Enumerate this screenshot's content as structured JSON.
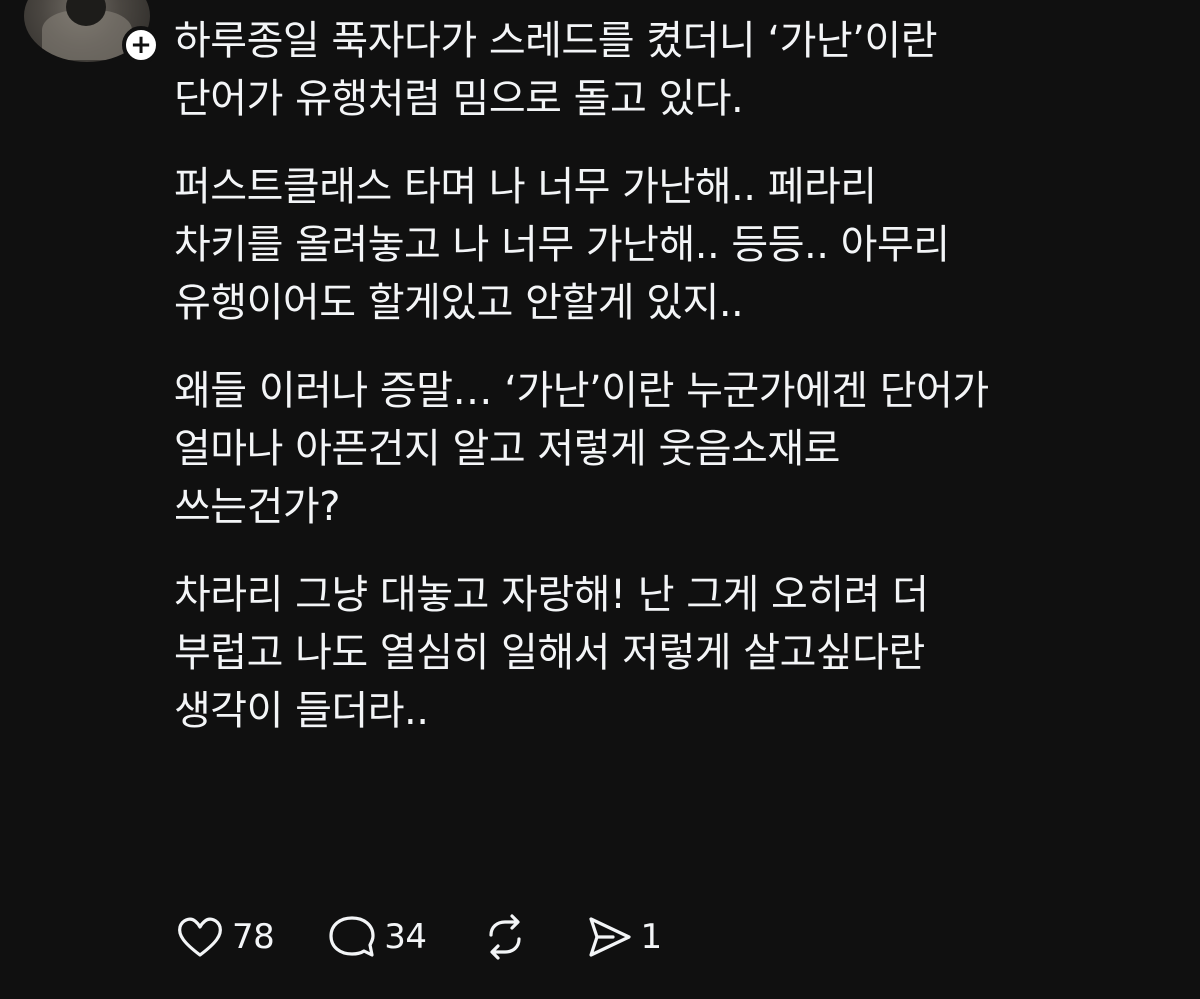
{
  "post": {
    "paragraphs": [
      "하루종일 푹자다가 스레드를 켰더니 ‘가난’이란\n단어가 유행처럼 밈으로 돌고 있다.",
      "퍼스트클래스 타며 나 너무 가난해.. 페라리\n차키를 올려놓고 나 너무 가난해.. 등등.. 아무리\n유행이어도 할게있고 안할게 있지..",
      "왜들 이러나 증말… ‘가난’이란 누군가에겐 단어가\n얼마나 아픈건지 알고 저렇게 웃음소재로\n쓰는건가?",
      "차라리 그냥 대놓고 자랑해! 난 그게 오히려 더\n부럽고 나도 열심히 일해서 저렇게 살고싶다란\n생각이 들더라.."
    ]
  },
  "author": {
    "follow_badge": "+"
  },
  "actions": {
    "like": {
      "icon": "heart-icon",
      "count": "78"
    },
    "comment": {
      "icon": "comment-bubble-icon",
      "count": "34"
    },
    "repost": {
      "icon": "repost-icon"
    },
    "share": {
      "icon": "send-icon",
      "count": "1"
    }
  },
  "colors": {
    "background": "#101010",
    "text": "#f3f5f7"
  }
}
